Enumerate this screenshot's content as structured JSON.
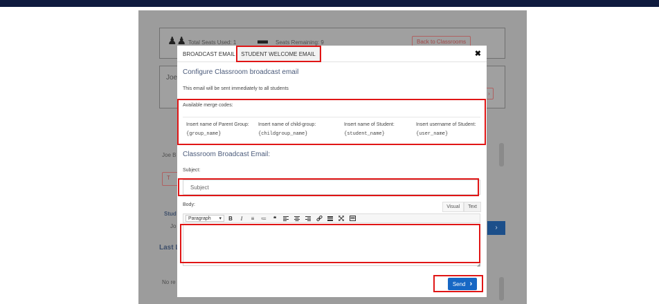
{
  "background": {
    "total_seats": "Total Seats Used: 1",
    "seats_remaining": "Seats Remaining: 9",
    "back_button": "Back to Classrooms",
    "student_name_short": "Joe",
    "student_name": "Joe B",
    "section_student": "Stud",
    "row_text": "Jo",
    "last_label": "Last L",
    "no_records": "No re"
  },
  "modal": {
    "tabs": [
      "BROADCAST EMAIL",
      "STUDENT WELCOME EMAIL"
    ],
    "close_glyph": "✖",
    "title": "Configure Classroom broadcast email",
    "info": "This email will be sent immediately to all students",
    "merge_heading": "Available merge codes:",
    "merge_codes": [
      {
        "label": "Insert name of Parent Group:",
        "code": "{group_name}"
      },
      {
        "label": "Insert name of child-group:",
        "code": "{childgroup_name}"
      },
      {
        "label": "Insert name of Student:",
        "code": "{student_name}"
      },
      {
        "label": "Insert username of Student:",
        "code": "{user_name}"
      }
    ],
    "section_title": "Classroom Broadcast Email:",
    "subject_label": "Subject:",
    "subject_placeholder": "Subject",
    "body_label": "Body:",
    "editor_tabs": [
      "Visual",
      "Text"
    ],
    "format_select": "Paragraph",
    "send_label": "Send",
    "send_icon": "›"
  },
  "colors": {
    "topbar": "#0f1b3f",
    "accent_blue": "#1767c4",
    "highlight_red": "#e01515"
  }
}
